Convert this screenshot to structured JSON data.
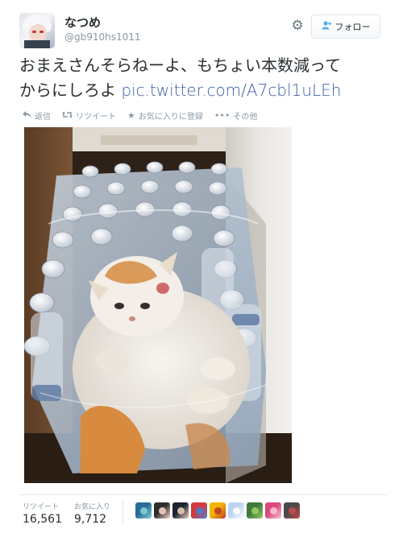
{
  "user": {
    "name": "なつめ",
    "handle": "@gb910hs1011"
  },
  "header": {
    "settings_icon": "gear-icon",
    "follow_label": "フォロー",
    "follow_icon": "add-person-icon"
  },
  "tweet": {
    "text_line1": "おまえさんそらねーよ、もちょい本数減って",
    "text_line2": "からにしろよ",
    "link": "pic.twitter.com/A7cbl1uLEh"
  },
  "actions": [
    {
      "label": "返信",
      "icon": "reply-icon"
    },
    {
      "label": "リツイート",
      "icon": "retweet-icon"
    },
    {
      "label": "お気に入りに登録",
      "icon": "star-icon"
    },
    {
      "label": "その他",
      "icon": "more-icon"
    }
  ],
  "photo": {
    "subject": "cat-on-water-bottle-pack"
  },
  "stats": {
    "retweets_label": "リツイート",
    "retweets_value": "16,561",
    "favorites_label": "お気に入り",
    "favorites_value": "9,712"
  },
  "favoriters": [
    {
      "colors": [
        "#2a6b9a",
        "#7fd0d6"
      ]
    },
    {
      "colors": [
        "#2d2d2d",
        "#f3d3c4"
      ]
    },
    {
      "colors": [
        "#1c2331",
        "#e7c8b8"
      ]
    },
    {
      "colors": [
        "#d23b3b",
        "#4a7fd2"
      ]
    },
    {
      "colors": [
        "#f2b705",
        "#c0392b"
      ]
    },
    {
      "colors": [
        "#bcd4f2",
        "#ffffff"
      ]
    },
    {
      "colors": [
        "#3f7a3c",
        "#9acd5f"
      ]
    },
    {
      "colors": [
        "#d94a7a",
        "#f7c4d2"
      ]
    },
    {
      "colors": [
        "#4a4a4a",
        "#c84b4b"
      ]
    }
  ],
  "colors": {
    "link": "#3b5ea7",
    "muted": "#8899a6",
    "text": "#292f33",
    "accent": "#55acee"
  }
}
